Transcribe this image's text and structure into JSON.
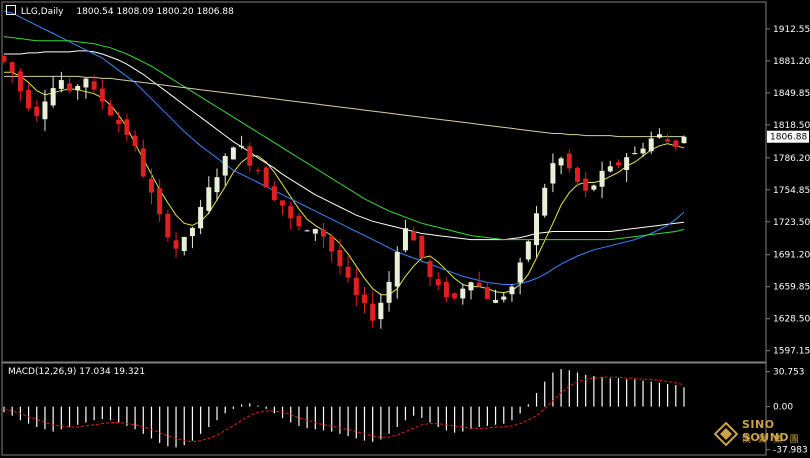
{
  "header": {
    "symbol": "LLG,Daily",
    "ohlc": "1800.54 1808.09 1800.20 1806.88"
  },
  "macd_header": {
    "label": "MACD(12,26,9) 17.034 19.321"
  },
  "logo": {
    "name_en": "SINO SOUND",
    "name_cn": "漢 聲 集 團"
  },
  "colors": {
    "background": "#000000",
    "bull": "#e8f0d8",
    "bear": "#e02020",
    "ma_yellow": "#e6e64a",
    "ma_white": "#ffffff",
    "ma_blue": "#3a86ff",
    "ma_green": "#3cd63c",
    "ma_tan": "#d6cfa0",
    "current_price_bg": "#ffffff",
    "signal": "#e02020"
  },
  "chart_data": [
    {
      "type": "candlestick",
      "title": "LLG,Daily",
      "ylim": [
        1590,
        1935
      ],
      "y_ticks": [
        "1912.55",
        "1881.20",
        "1849.85",
        "1818.50",
        "1786.20",
        "1754.85",
        "1723.50",
        "1691.20",
        "1659.85",
        "1628.50",
        "1597.15"
      ],
      "current_price": "1806.88",
      "last_bar": {
        "open": 1800.54,
        "high": 1808.09,
        "low": 1800.2,
        "close": 1806.88
      },
      "close_path": [
        1880,
        1870,
        1852,
        1838,
        1830,
        1845,
        1855,
        1862,
        1848,
        1858,
        1865,
        1850,
        1842,
        1830,
        1820,
        1810,
        1795,
        1770,
        1750,
        1728,
        1712,
        1698,
        1705,
        1718,
        1735,
        1755,
        1770,
        1785,
        1800,
        1795,
        1782,
        1775,
        1760,
        1748,
        1740,
        1725,
        1718,
        1712,
        1718,
        1710,
        1695,
        1680,
        1665,
        1650,
        1640,
        1630,
        1645,
        1665,
        1695,
        1720,
        1705,
        1688,
        1668,
        1658,
        1652,
        1648,
        1660,
        1668,
        1660,
        1650,
        1645,
        1652,
        1660,
        1680,
        1705,
        1730,
        1758,
        1780,
        1785,
        1775,
        1762,
        1752,
        1760,
        1770,
        1775,
        1780,
        1788,
        1790,
        1798,
        1805,
        1808,
        1802,
        1800,
        1806
      ],
      "moving_averages": [
        {
          "color": "#e6e64a",
          "values": [
            1870,
            1870,
            1866,
            1860,
            1852,
            1848,
            1850,
            1852,
            1854,
            1853,
            1851,
            1849,
            1845,
            1838,
            1828,
            1816,
            1800,
            1785,
            1770,
            1755,
            1742,
            1730,
            1722,
            1720,
            1724,
            1732,
            1745,
            1758,
            1772,
            1782,
            1788,
            1788,
            1782,
            1772,
            1760,
            1748,
            1736,
            1726,
            1720,
            1715,
            1710,
            1702,
            1692,
            1680,
            1668,
            1658,
            1652,
            1652,
            1658,
            1670,
            1680,
            1688,
            1690,
            1684,
            1676,
            1668,
            1662,
            1660,
            1660,
            1658,
            1655,
            1654,
            1656,
            1662,
            1672,
            1688,
            1705,
            1722,
            1740,
            1752,
            1760,
            1762,
            1762,
            1764,
            1768,
            1772,
            1778,
            1782,
            1788,
            1794,
            1798,
            1800,
            1798,
            1796
          ]
        },
        {
          "color": "#ffffff",
          "values": [
            1888,
            1888,
            1888,
            1889,
            1889,
            1890,
            1890,
            1890,
            1890,
            1891,
            1891,
            1890,
            1888,
            1885,
            1882,
            1878,
            1873,
            1868,
            1862,
            1856,
            1850,
            1844,
            1838,
            1832,
            1826,
            1820,
            1814,
            1808,
            1802,
            1797,
            1792,
            1786,
            1781,
            1776,
            1770,
            1765,
            1760,
            1755,
            1750,
            1746,
            1742,
            1738,
            1734,
            1730,
            1727,
            1724,
            1722,
            1720,
            1718,
            1716,
            1714,
            1712,
            1711,
            1710,
            1709,
            1708,
            1707,
            1706,
            1706,
            1706,
            1706,
            1706,
            1707,
            1708,
            1710,
            1712,
            1713,
            1714,
            1714,
            1714,
            1714,
            1714,
            1714,
            1714,
            1714,
            1715,
            1716,
            1717,
            1718,
            1719,
            1720,
            1721,
            1722,
            1723
          ]
        },
        {
          "color": "#3a86ff",
          "values": [
            1930,
            1928,
            1924,
            1920,
            1916,
            1912,
            1908,
            1904,
            1900,
            1896,
            1892,
            1888,
            1884,
            1878,
            1872,
            1866,
            1860,
            1852,
            1844,
            1836,
            1828,
            1820,
            1812,
            1805,
            1798,
            1792,
            1786,
            1780,
            1774,
            1770,
            1766,
            1762,
            1758,
            1754,
            1750,
            1746,
            1742,
            1738,
            1734,
            1730,
            1726,
            1722,
            1718,
            1714,
            1710,
            1706,
            1702,
            1698,
            1694,
            1691,
            1688,
            1685,
            1682,
            1679,
            1676,
            1673,
            1670,
            1668,
            1666,
            1664,
            1663,
            1662,
            1662,
            1663,
            1665,
            1668,
            1672,
            1677,
            1682,
            1686,
            1690,
            1693,
            1696,
            1698,
            1700,
            1702,
            1704,
            1706,
            1709,
            1712,
            1716,
            1720,
            1726,
            1733
          ]
        },
        {
          "color": "#3cd63c",
          "values": [
            1905,
            1904,
            1903,
            1902,
            1901,
            1901,
            1901,
            1901,
            1901,
            1900,
            1899,
            1898,
            1896,
            1894,
            1891,
            1888,
            1884,
            1880,
            1876,
            1871,
            1866,
            1861,
            1856,
            1851,
            1846,
            1841,
            1836,
            1831,
            1826,
            1821,
            1816,
            1811,
            1806,
            1801,
            1796,
            1791,
            1786,
            1781,
            1776,
            1771,
            1766,
            1761,
            1756,
            1751,
            1746,
            1742,
            1738,
            1734,
            1731,
            1728,
            1725,
            1722,
            1720,
            1718,
            1716,
            1714,
            1712,
            1710,
            1709,
            1708,
            1707,
            1706,
            1706,
            1706,
            1706,
            1706,
            1706,
            1706,
            1706,
            1706,
            1706,
            1706,
            1706,
            1706,
            1706,
            1707,
            1708,
            1709,
            1710,
            1711,
            1712,
            1713,
            1714,
            1716
          ]
        },
        {
          "color": "#d6cfa0",
          "values": [
            1866,
            1866,
            1866,
            1866,
            1866,
            1866,
            1866,
            1866,
            1866,
            1866,
            1865,
            1865,
            1864,
            1864,
            1863,
            1862,
            1861,
            1860,
            1859,
            1858,
            1857,
            1856,
            1855,
            1854,
            1853,
            1852,
            1851,
            1850,
            1849,
            1848,
            1847,
            1846,
            1845,
            1844,
            1843,
            1842,
            1841,
            1840,
            1839,
            1838,
            1837,
            1836,
            1835,
            1834,
            1833,
            1832,
            1831,
            1830,
            1829,
            1828,
            1827,
            1826,
            1825,
            1824,
            1823,
            1822,
            1821,
            1820,
            1819,
            1818,
            1817,
            1816,
            1815,
            1814,
            1813,
            1812,
            1811,
            1810,
            1810,
            1809,
            1809,
            1808,
            1808,
            1808,
            1808,
            1807,
            1807,
            1807,
            1807,
            1807,
            1807,
            1807,
            1807,
            1807
          ]
        }
      ]
    },
    {
      "type": "bar",
      "title": "MACD(12,26,9) 17.034 19.321",
      "ylim": [
        -40,
        34
      ],
      "y_ticks": [
        "30.753",
        "0.00",
        "-37.983"
      ],
      "macd_value": 17.034,
      "signal_value": 19.321,
      "macd_path": [
        -5,
        -8,
        -12,
        -15,
        -18,
        -20,
        -22,
        -20,
        -18,
        -16,
        -14,
        -12,
        -11,
        -12,
        -14,
        -17,
        -20,
        -24,
        -28,
        -32,
        -35,
        -36,
        -34,
        -30,
        -24,
        -18,
        -12,
        -6,
        -2,
        2,
        3,
        1,
        -2,
        -6,
        -10,
        -14,
        -17,
        -19,
        -20,
        -21,
        -22,
        -24,
        -26,
        -28,
        -30,
        -31,
        -29,
        -24,
        -18,
        -12,
        -8,
        -10,
        -14,
        -18,
        -21,
        -23,
        -22,
        -20,
        -18,
        -17,
        -16,
        -15,
        -12,
        -6,
        2,
        12,
        22,
        30,
        33,
        32,
        30,
        28,
        27,
        26,
        25,
        25,
        24,
        24,
        23,
        22,
        21,
        20,
        19,
        17
      ],
      "signal_path": [
        -2,
        -4,
        -6,
        -9,
        -11,
        -14,
        -16,
        -17,
        -18,
        -18,
        -17,
        -16,
        -15,
        -14,
        -14,
        -15,
        -16,
        -18,
        -20,
        -23,
        -26,
        -28,
        -30,
        -31,
        -30,
        -28,
        -25,
        -21,
        -17,
        -12,
        -8,
        -5,
        -4,
        -4,
        -5,
        -7,
        -10,
        -12,
        -14,
        -16,
        -17,
        -19,
        -20,
        -22,
        -24,
        -26,
        -27,
        -27,
        -25,
        -22,
        -19,
        -16,
        -15,
        -15,
        -16,
        -17,
        -18,
        -19,
        -19,
        -19,
        -18,
        -18,
        -17,
        -15,
        -12,
        -8,
        -2,
        5,
        12,
        18,
        22,
        24,
        25,
        26,
        26,
        26,
        25,
        25,
        24,
        24,
        23,
        22,
        21,
        19
      ]
    }
  ]
}
